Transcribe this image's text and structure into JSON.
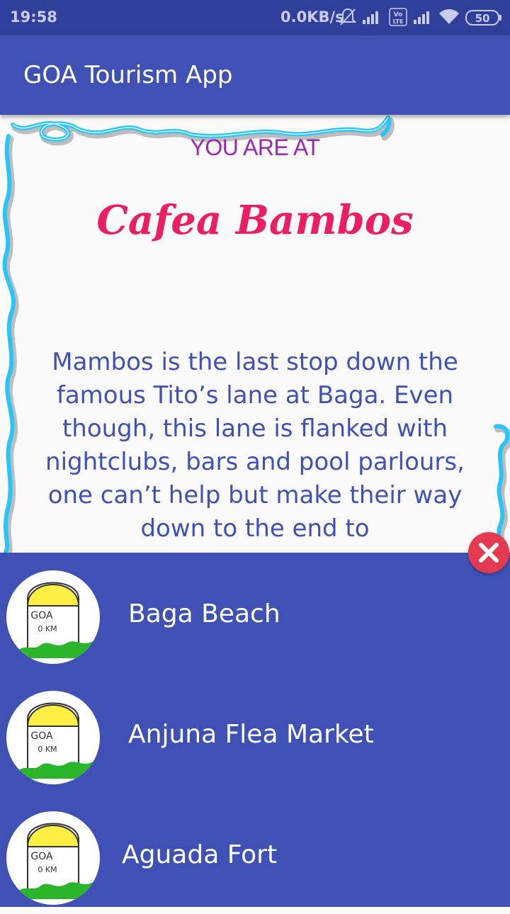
{
  "status_bar": {
    "time": "19:58",
    "network_speed": "0.0KB/s",
    "battery": "50"
  },
  "app_bar": {
    "title": "GOA Tourism App"
  },
  "main": {
    "you_are_at": "YOU ARE AT",
    "place_name": "Cafea Bambos",
    "description": "Mambos is the last stop down the famous Tito’s lane at Baga. Even though, this lane is flanked with nightclubs, bars and pool parlours, one can’t help but make their way down to the end to"
  },
  "sheet": {
    "items": [
      {
        "label": "Baga Beach",
        "icon": "milestone-icon",
        "icon_text": "GOA 0 KM"
      },
      {
        "label": "Anjuna Flea Market",
        "icon": "milestone-icon",
        "icon_text": "GOA 0 KM"
      },
      {
        "label": "Aguada Fort",
        "icon": "milestone-icon",
        "icon_text": "GOA 0 KM"
      }
    ],
    "close_icon": "close-icon"
  },
  "colors": {
    "primary": "#3f51b5",
    "primary_dark": "#30409a",
    "accent_pink": "#e91e63",
    "purple": "#9c27b0",
    "border_cyan": "#29c5f6",
    "close_red": "#e53950"
  }
}
